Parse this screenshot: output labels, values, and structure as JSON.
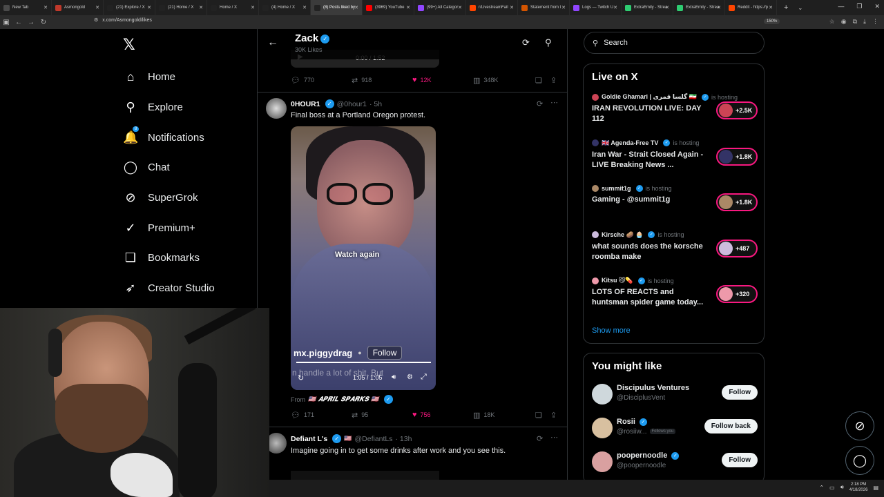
{
  "browser": {
    "tabs": [
      {
        "title": "New Tab",
        "color": "#4a4a4a"
      },
      {
        "title": "Asmongold",
        "color": "#c0392b"
      },
      {
        "title": "(21) Explore / X",
        "color": "#222222"
      },
      {
        "title": "(21) Home / X",
        "color": "#222222"
      },
      {
        "title": "Home / X",
        "color": "#222222"
      },
      {
        "title": "(4) Home / X",
        "color": "#222222"
      },
      {
        "title": "(8) Posts liked by",
        "color": "#222222",
        "active": true
      },
      {
        "title": "(3969) YouTube",
        "color": "#ff0000"
      },
      {
        "title": "(99+) All Categor",
        "color": "#9146ff"
      },
      {
        "title": "r/LivestreamFail",
        "color": "#ff4500"
      },
      {
        "title": "Statement from t",
        "color": "#d35400"
      },
      {
        "title": "Logs — Twitch U",
        "color": "#9146ff"
      },
      {
        "title": "ExtraEmily - Strea",
        "color": "#2ecc71"
      },
      {
        "title": "ExtraEmily - Strea",
        "color": "#2ecc71"
      },
      {
        "title": "Reddit - https://p",
        "color": "#ff4500"
      }
    ],
    "url": "x.com/Asmongold/likes",
    "zoom": "150%"
  },
  "nav": {
    "items": [
      {
        "label": "Home",
        "icon": "home-icon",
        "glyph": "⌂"
      },
      {
        "label": "Explore",
        "icon": "search-icon",
        "glyph": "⚲"
      },
      {
        "label": "Notifications",
        "icon": "bell-icon",
        "glyph": "🔔",
        "badge": "8"
      },
      {
        "label": "Chat",
        "icon": "chat-icon",
        "glyph": "◯"
      },
      {
        "label": "SuperGrok",
        "icon": "grok-icon",
        "glyph": "⊘"
      },
      {
        "label": "Premium+",
        "icon": "premium-icon",
        "glyph": "✓"
      },
      {
        "label": "Bookmarks",
        "icon": "bookmark-icon",
        "glyph": "❏"
      },
      {
        "label": "Creator Studio",
        "icon": "rocket-icon",
        "glyph": "➶"
      }
    ]
  },
  "profile": {
    "name": "Zack",
    "likes": "30K Likes"
  },
  "prev_tweet": {
    "video_time": "0:00 / 1:52",
    "replies": "770",
    "reposts": "918",
    "likes": "12K",
    "views": "348K"
  },
  "tweet1": {
    "name": "0HOUR1",
    "handle": "@0hour1",
    "time": "· 5h",
    "text": "Final boss at a Portland Oregon protest.",
    "video": {
      "overlay": "Watch again",
      "user": "mx.piggydrag",
      "follow": "Follow",
      "subtitle": "n handle a lot of shit. But",
      "time": "1:05 / 1:05"
    },
    "from_label": "From",
    "from_name": "🇺🇸 𝑨𝑷𝑹𝑰𝑳 𝑺𝑷𝑨𝑹𝑲𝑺 🇺🇸",
    "replies": "171",
    "reposts": "95",
    "likes": "756",
    "views": "18K"
  },
  "tweet2": {
    "name": "Defiant L's",
    "handle": "@DefiantLs",
    "time": "· 13h",
    "text": "Imagine going in to get some drinks after work and you see this."
  },
  "search": {
    "placeholder": "Search"
  },
  "live": {
    "title": "Live on X",
    "items": [
      {
        "host": "Goldie Ghamari | گلسا قمری 🇮🇷",
        "status": "is hosting",
        "title": "IRAN REVOLUTION LIVE: DAY 112",
        "count": "+2.5K"
      },
      {
        "host": "🇬🇧 Agenda-Free TV",
        "status": "is hosting",
        "title": "Iran War - Strait Closed Again - LIVE Breaking News ...",
        "count": "+1.8K"
      },
      {
        "host": "summit1g",
        "status": "is hosting",
        "title": "Gaming - @summit1g",
        "count": "+1.8K"
      },
      {
        "host": "Kirsche 🥔 🧁",
        "status": "is hosting",
        "title": "what sounds does the korsche roomba make",
        "count": "+487"
      },
      {
        "host": "Kitsu 😼💊",
        "status": "is hosting",
        "title": "LOTS OF REACTS and huntsman spider game today...",
        "count": "+320"
      }
    ],
    "show_more": "Show more"
  },
  "wtf": {
    "title": "You might like",
    "items": [
      {
        "name": "Discipulus Ventures",
        "handle": "@DisciplusVent",
        "button": "Follow",
        "follows_you": ""
      },
      {
        "name": "Rosii",
        "handle": "@rosiiw...",
        "button": "Follow back",
        "follows_you": "Follows you"
      },
      {
        "name": "poopernoodle",
        "handle": "@poopernoodle",
        "button": "Follow",
        "follows_you": ""
      }
    ]
  },
  "taskbar": {
    "time": "2:18 PM",
    "date": "4/18/2026"
  },
  "colors": {
    "accent": "#1d9bf0",
    "like": "#f91880",
    "bg": "#000000",
    "border": "#2f3336"
  }
}
